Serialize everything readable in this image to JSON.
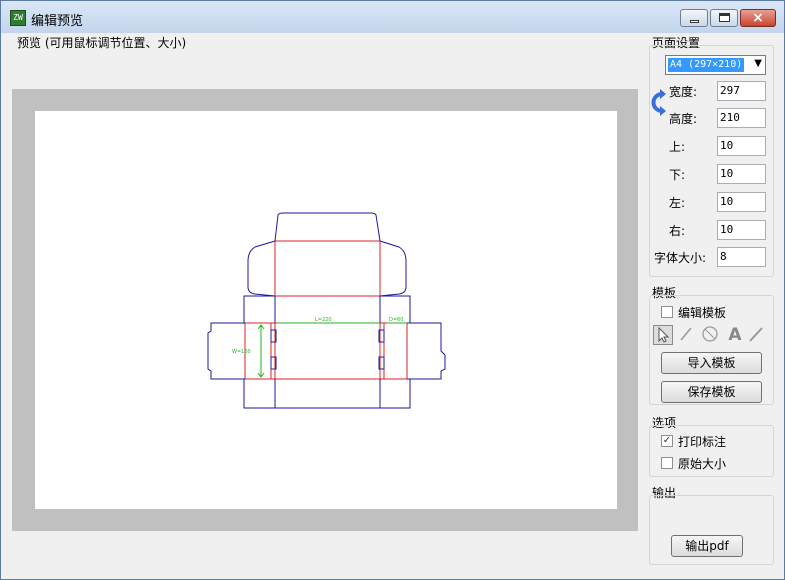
{
  "window": {
    "title": "编辑预览"
  },
  "preview": {
    "label": "预览 (可用鼠标调节位置、大小)",
    "annotations": {
      "length": "L=220",
      "width": "W=160",
      "depth": "D=60"
    }
  },
  "page_settings": {
    "title": "页面设置",
    "paper_size": "A4 (297×210)",
    "width_label": "宽度:",
    "width": "297",
    "height_label": "高度:",
    "height": "210",
    "top_label": "上:",
    "top": "10",
    "bottom_label": "下:",
    "bottom": "10",
    "left_label": "左:",
    "left": "10",
    "right_label": "右:",
    "right": "10",
    "font_size_label": "字体大小:",
    "font_size": "8"
  },
  "template": {
    "title": "模板",
    "edit_label": "编辑模板",
    "edit_checked": false,
    "tools": [
      "pointer-icon",
      "line-icon",
      "circle-icon",
      "text-icon",
      "pen-icon"
    ],
    "text_tool_glyph": "A",
    "import_label": "导入模板",
    "save_label": "保存模板"
  },
  "options": {
    "title": "选项",
    "print_label": "打印标注",
    "print_checked": true,
    "original_size_label": "原始大小",
    "original_checked": false
  },
  "output": {
    "title": "输出",
    "pdf_label": "输出pdf"
  },
  "colors": {
    "cut_line": "#1a1a9c",
    "fold_line": "#e02020",
    "dimension": "#21b521"
  }
}
